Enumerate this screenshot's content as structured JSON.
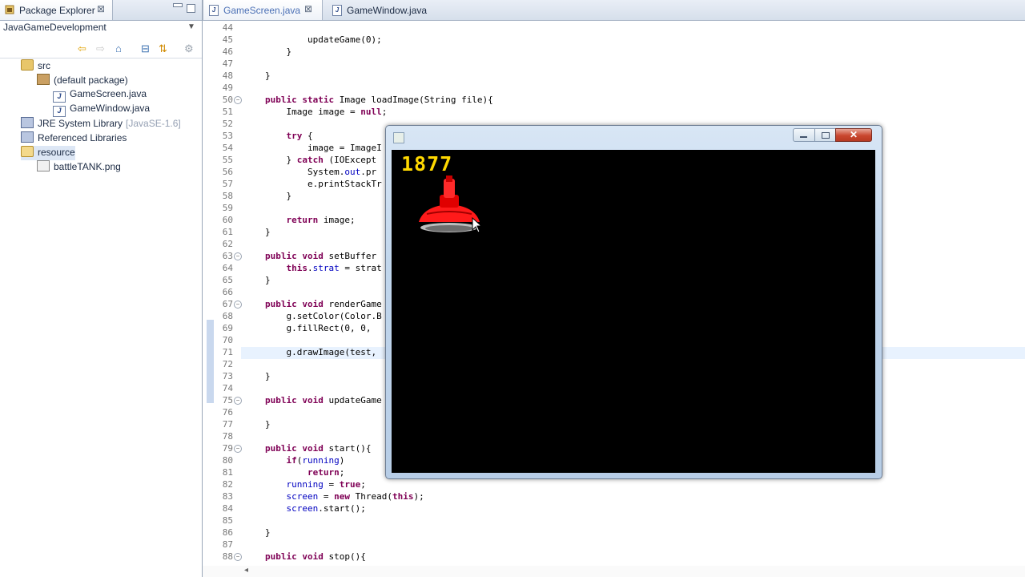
{
  "package_explorer": {
    "tab_label": "Package Explorer",
    "close_symbol": "⊠",
    "project": "JavaGameDevelopment",
    "tree": [
      {
        "label": "src",
        "icon": "source-folder-icon",
        "indent": 1
      },
      {
        "label": "(default package)",
        "icon": "package-icon",
        "indent": 2
      },
      {
        "label": "GameScreen.java",
        "icon": "java-file-icon",
        "indent": 3
      },
      {
        "label": "GameWindow.java",
        "icon": "java-file-icon",
        "indent": 3
      },
      {
        "label": "JRE System Library",
        "suffix": "[JavaSE-1.6]",
        "icon": "library-icon",
        "indent": 1
      },
      {
        "label": "Referenced Libraries",
        "icon": "library-icon",
        "indent": 1
      },
      {
        "label": "resource",
        "icon": "folder-icon",
        "indent": 1,
        "selected": true
      },
      {
        "label": "battleTANK.png",
        "icon": "image-file-icon",
        "indent": 2
      }
    ]
  },
  "editor": {
    "tabs": [
      {
        "label": "GameScreen.java",
        "active": true
      },
      {
        "label": "GameWindow.java",
        "active": false
      }
    ],
    "lines": [
      {
        "n": "44",
        "html": ""
      },
      {
        "n": "45",
        "html": "        updateGame(0);"
      },
      {
        "n": "46",
        "html": "    }"
      },
      {
        "n": "47",
        "html": ""
      },
      {
        "n": "48",
        "html": "}"
      },
      {
        "n": "49",
        "html": ""
      },
      {
        "n": "50",
        "fold": true,
        "html": "<span class=\"kw\">public</span> <span class=\"kw\">static</span> Image loadImage(String file){"
      },
      {
        "n": "51",
        "html": "    Image image = <span class=\"kw\">null</span>;"
      },
      {
        "n": "52",
        "html": ""
      },
      {
        "n": "53",
        "html": "    <span class=\"kw\">try</span> {"
      },
      {
        "n": "54",
        "html": "        image = ImageI"
      },
      {
        "n": "55",
        "html": "    } <span class=\"kw\">catch</span> (IOExcept"
      },
      {
        "n": "56",
        "html": "        System.<span class=\"fld\">out</span>.pr"
      },
      {
        "n": "57",
        "html": "        e.printStackTr"
      },
      {
        "n": "58",
        "html": "    }"
      },
      {
        "n": "59",
        "html": ""
      },
      {
        "n": "60",
        "html": "    <span class=\"kw\">return</span> image;"
      },
      {
        "n": "61",
        "html": "}"
      },
      {
        "n": "62",
        "html": ""
      },
      {
        "n": "63",
        "fold": true,
        "html": "<span class=\"kw\">public</span> <span class=\"kw\">void</span> setBuffer"
      },
      {
        "n": "64",
        "html": "    <span class=\"kw\">this</span>.<span class=\"fld\">strat</span> = strat"
      },
      {
        "n": "65",
        "html": "}"
      },
      {
        "n": "66",
        "html": ""
      },
      {
        "n": "67",
        "fold": true,
        "html": "<span class=\"kw\">public</span> <span class=\"kw\">void</span> renderGame"
      },
      {
        "n": "68",
        "html": "    g.setColor(Color.B"
      },
      {
        "n": "69",
        "html": "    g.fillRect(0, 0, "
      },
      {
        "n": "70",
        "html": ""
      },
      {
        "n": "71",
        "html": "    g.drawImage(test,"
      },
      {
        "n": "72",
        "html": ""
      },
      {
        "n": "73",
        "html": "}"
      },
      {
        "n": "74",
        "html": ""
      },
      {
        "n": "75",
        "fold": true,
        "html": "<span class=\"kw\">public</span> <span class=\"kw\">void</span> updateGame"
      },
      {
        "n": "76",
        "html": ""
      },
      {
        "n": "77",
        "html": "}"
      },
      {
        "n": "78",
        "html": ""
      },
      {
        "n": "79",
        "fold": true,
        "html": "<span class=\"kw\">public</span> <span class=\"kw\">void</span> start(){"
      },
      {
        "n": "80",
        "html": "    <span class=\"kw\">if</span>(<span class=\"fld\">running</span>)"
      },
      {
        "n": "81",
        "html": "        <span class=\"kw\">return</span>;"
      },
      {
        "n": "82",
        "html": "    <span class=\"fld\">running</span> = <span class=\"kw\">true</span>;"
      },
      {
        "n": "83",
        "html": "    <span class=\"fld\">screen</span> = <span class=\"kw\">new</span> Thread(<span class=\"kw\">this</span>);"
      },
      {
        "n": "84",
        "html": "    <span class=\"fld\">screen</span>.start();"
      },
      {
        "n": "85",
        "html": ""
      },
      {
        "n": "86",
        "html": "}"
      },
      {
        "n": "87",
        "html": ""
      },
      {
        "n": "88",
        "fold": true,
        "html": "<span class=\"kw\">public</span> <span class=\"kw\">void</span> stop(){"
      }
    ]
  },
  "game_window": {
    "score": "1877",
    "close_symbol": "✕"
  }
}
